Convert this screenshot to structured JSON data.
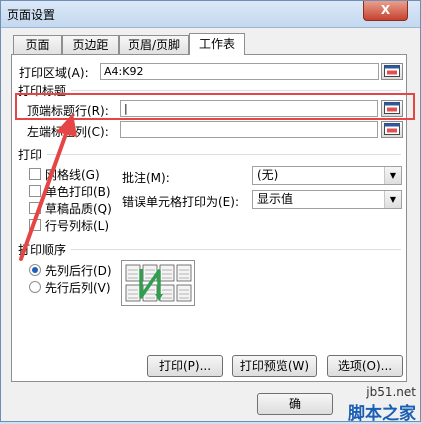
{
  "window": {
    "title": "页面设置",
    "close_glyph": "X"
  },
  "tabs": [
    {
      "label": "页面"
    },
    {
      "label": "页边距"
    },
    {
      "label": "页眉/页脚"
    },
    {
      "label": "工作表"
    }
  ],
  "print_area": {
    "label": "打印区域(A):",
    "value": "A4:K92"
  },
  "print_titles": {
    "group_label": "打印标题",
    "top_rows_label": "顶端标题行(R):",
    "top_rows_value": "|",
    "left_cols_label": "左端标题列(C):",
    "left_cols_value": ""
  },
  "print": {
    "group_label": "打印",
    "gridlines": "网格线(G)",
    "black_white": "单色打印(B)",
    "draft": "草稿品质(Q)",
    "row_col_headings": "行号列标(L)",
    "comments_label": "批注(M):",
    "comments_value": "(无)",
    "errors_label": "错误单元格打印为(E):",
    "errors_value": "显示值"
  },
  "page_order": {
    "group_label": "打印顺序",
    "down_then_over": "先列后行(D)",
    "over_then_down": "先行后列(V)",
    "selected": "down_then_over"
  },
  "buttons": {
    "print": "打印(P)...",
    "print_preview": "打印预览(W)",
    "options": "选项(O)...",
    "ok": "确"
  },
  "watermark": {
    "site": "jb51.net",
    "brand": "脚本之家"
  },
  "colors": {
    "highlight": "#e64545",
    "accent": "#1c5fb8"
  }
}
